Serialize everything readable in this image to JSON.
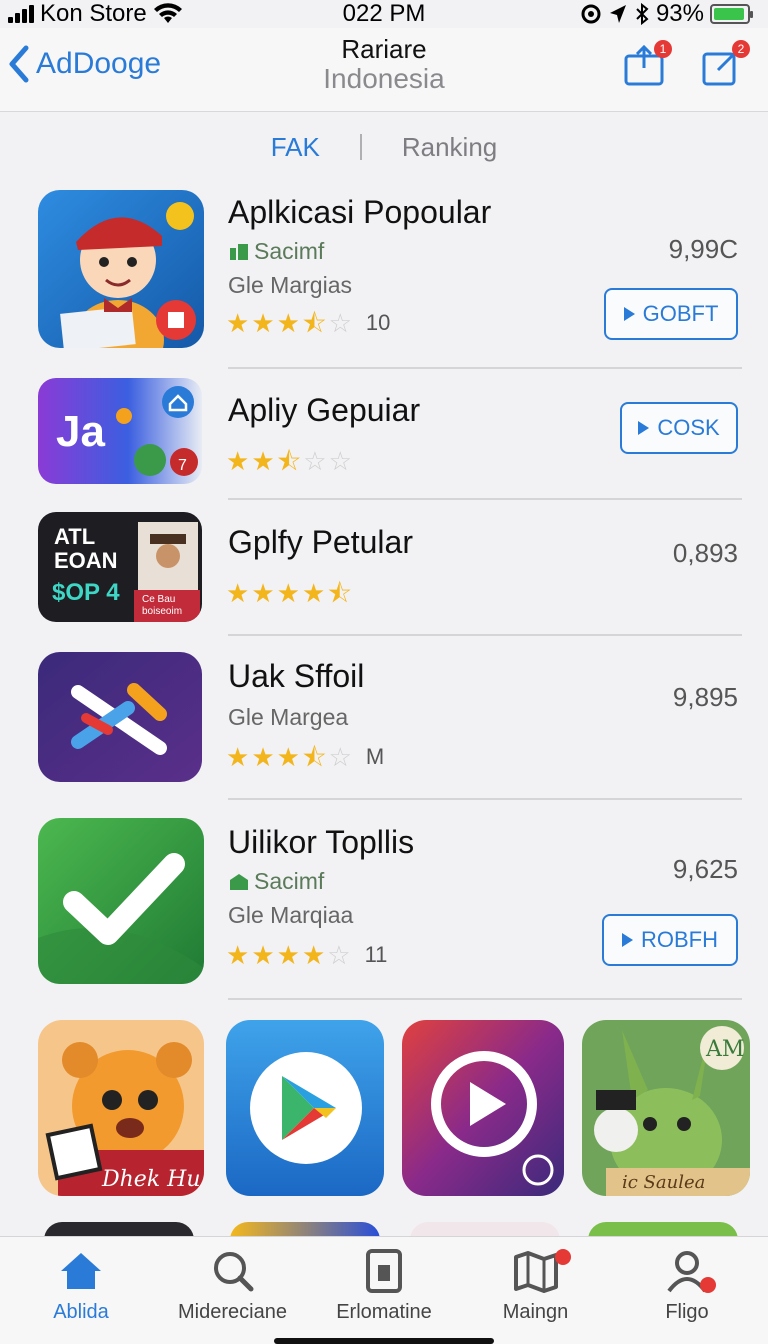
{
  "status_bar": {
    "carrier": "Kon Store",
    "time": "022 PM",
    "battery": "93%",
    "battery_level": 0.93
  },
  "nav": {
    "back_label": "AdDooge",
    "title": "Rariare",
    "subtitle": "Indonesia",
    "badge_left": "1",
    "badge_right": "2"
  },
  "segments": {
    "first": "FAK",
    "second": "Ranking"
  },
  "apps": [
    {
      "name": "Aplkicasi Popoular",
      "developer": "Sacimf",
      "category": "Gle Margias",
      "rating": 3.5,
      "rating_count": "10",
      "price": "9,99C",
      "button": "GOBFT"
    },
    {
      "name": "Apliy Gepuiar",
      "rating": 2.5,
      "button": "COSK"
    },
    {
      "name": "Gplfy Petular",
      "rating": 4.5,
      "price": "0,893"
    },
    {
      "name": "Uak Sffoil",
      "category": "Gle Margea",
      "rating": 3.5,
      "rating_count": "M",
      "price": "9,895"
    },
    {
      "name": "Uilikor Topllis",
      "developer": "Sacimf",
      "category": "Gle Marqiaa",
      "rating": 4,
      "rating_count": "11",
      "price": "9,625",
      "button": "ROBFH"
    }
  ],
  "icon_texts": {
    "app2_logo": "Ja",
    "app3_line1": "ATL",
    "app3_line2": "EOAN",
    "app3_line3": "$OP 4",
    "app3_tag1": "Ce Bau",
    "app3_tag2": "boiseoim",
    "grid1_caption": "Dhek Hugeos",
    "grid4_top": "AM",
    "grid4_caption": "ic Saulea"
  },
  "tabs": [
    {
      "label": "Ablida",
      "icon": "home-icon",
      "active": true
    },
    {
      "label": "Midereciane",
      "icon": "search-icon"
    },
    {
      "label": "Erlomatine",
      "icon": "card-icon"
    },
    {
      "label": "Maingn",
      "icon": "map-icon",
      "badge": true
    },
    {
      "label": "Fligo",
      "icon": "profile-icon",
      "badge": true
    }
  ],
  "colors": {
    "accent": "#2a7bd8",
    "star": "#f3b51c",
    "badge": "#e53935"
  }
}
